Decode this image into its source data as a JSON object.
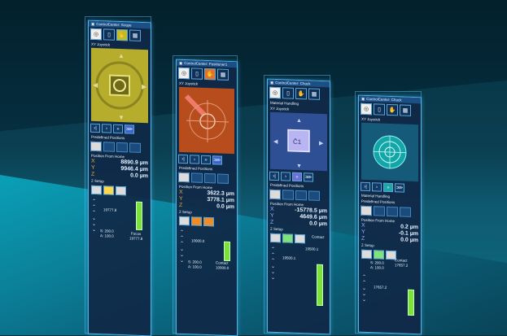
{
  "panels": {
    "p1": {
      "title": "ControlCenter: Scope",
      "joystick": "XY Joystick",
      "presets": "Predefined Positions",
      "home": "Position From Home",
      "x": "8890.9 µm",
      "y": "9946.4 µm",
      "z": "0.0 µm",
      "zsetup": "Z Setup",
      "zval": "19777.8",
      "zmode": "Focus",
      "zval2": "19777.8",
      "s": "S: 200.0",
      "a": "A: 100.0",
      "zlevel": 0.55
    },
    "p2": {
      "title": "ControlCenter: Positioner1",
      "joystick": "XY Joystick",
      "presets": "Predefined Positions",
      "home": "Position From Home",
      "x": "3622.3 µm",
      "y": "3778.1 µm",
      "z": "0.0 µm",
      "zsetup": "Z Setup",
      "zval": "10000.0",
      "zmode": "Contact",
      "zval2": "10000.0",
      "s": "S: 200.0",
      "a": "A: 100.0",
      "zlevel": 0.4
    },
    "p3": {
      "title": "ControlCenter: Chuck",
      "material": "Material Handling",
      "joystick": "XY Joystick",
      "presets": "Predefined Positions",
      "home": "Position From Home",
      "x": "-15778.5 µm",
      "y": "4649.6 µm",
      "z": "0.0 µm",
      "zsetup": "Z Setup",
      "zmode": "Contact",
      "zval2": "19500.1",
      "zval": "19500.1",
      "zlevel": 0.7
    },
    "p4": {
      "title": "ControlCenter: Chuck",
      "joystick": "XY Joystick",
      "material": "Material Handling",
      "presets": "Predefined Positions",
      "home": "Position From Home",
      "x": "0.2 µm",
      "y": "-0.1 µm",
      "z": "0.0 µm",
      "zsetup": "Z Setup",
      "s": "S: 200.0",
      "a": "A: 100.0",
      "zmode": "Contact",
      "zval2": "17657.2",
      "zval": "17657.2",
      "zlevel": 0.55
    }
  },
  "axes": {
    "x": "X",
    "y": "Y",
    "z": "Z"
  },
  "colors": {
    "scope": "#c9c035",
    "positioner": "#c2541e",
    "chuck": "#6f78c8",
    "chuck2": "#16a3a8",
    "bar": "#7ee03b"
  }
}
